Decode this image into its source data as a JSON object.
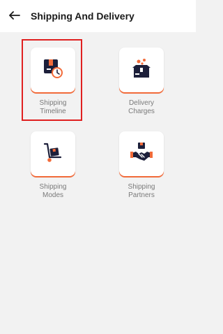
{
  "header": {
    "title": "Shipping And Delivery",
    "back_icon": "back-arrow-icon"
  },
  "tiles": [
    {
      "line1": "Shipping",
      "line2": "Timeline",
      "icon": "shipping-timeline-icon",
      "highlighted": true
    },
    {
      "line1": "Delivery",
      "line2": "Charges",
      "icon": "delivery-charges-icon",
      "highlighted": false
    },
    {
      "line1": "Shipping",
      "line2": "Modes",
      "icon": "shipping-modes-icon",
      "highlighted": false
    },
    {
      "line1": "Shipping",
      "line2": "Partners",
      "icon": "shipping-partners-icon",
      "highlighted": false
    }
  ],
  "colors": {
    "accent": "#f26b3a",
    "icon_dark": "#1c1f3a",
    "highlight_border": "#e02020"
  }
}
